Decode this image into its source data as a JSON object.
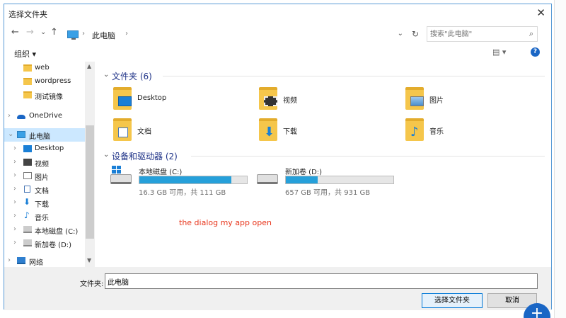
{
  "window": {
    "title": "选择文件夹",
    "close_glyph": "✕"
  },
  "nav": {
    "back": "←",
    "forward": "→",
    "recent": "⌄",
    "up": "↑",
    "breadcrumb": [
      "此电脑"
    ],
    "dropdown": "⌄",
    "refresh": "↻",
    "search_placeholder": "搜索\"此电脑\"",
    "search_icon": "⌕"
  },
  "toolbar": {
    "organize": "组织 ▾",
    "view_icon": "▤ ▾",
    "help": "?"
  },
  "sidebar": {
    "items": [
      {
        "label": "web",
        "icon": "folder-icon",
        "level": 2
      },
      {
        "label": "wordpress",
        "icon": "folder-icon",
        "level": 2
      },
      {
        "label": "测试镜像",
        "icon": "folder-icon",
        "level": 2
      },
      {
        "label": "OneDrive",
        "icon": "onedrive-icon",
        "level": 0,
        "arrow": "›"
      },
      {
        "label": "此电脑",
        "icon": "pc-icon",
        "level": 0,
        "arrow": "⌄",
        "selected": true
      },
      {
        "label": "Desktop",
        "icon": "desktop-icon",
        "level": 1,
        "arrow": "›"
      },
      {
        "label": "视频",
        "icon": "video-icon",
        "level": 1,
        "arrow": "›"
      },
      {
        "label": "图片",
        "icon": "picture-icon",
        "level": 1,
        "arrow": "›"
      },
      {
        "label": "文档",
        "icon": "document-icon",
        "level": 1,
        "arrow": "›"
      },
      {
        "label": "下载",
        "icon": "download-icon",
        "level": 1,
        "arrow": "›"
      },
      {
        "label": "音乐",
        "icon": "music-icon",
        "level": 1,
        "arrow": "›"
      },
      {
        "label": "本地磁盘 (C:)",
        "icon": "local-disk-icon",
        "level": 1,
        "arrow": "›"
      },
      {
        "label": "新加卷 (D:)",
        "icon": "drive-icon",
        "level": 1,
        "arrow": "›"
      },
      {
        "label": "网络",
        "icon": "network-icon",
        "level": 0,
        "arrow": "›"
      }
    ]
  },
  "groups": {
    "folders": {
      "title": "文件夹 (6)",
      "items": [
        {
          "name": "Desktop",
          "badge": "desktop"
        },
        {
          "name": "视频",
          "badge": "video"
        },
        {
          "name": "图片",
          "badge": "picture"
        },
        {
          "name": "文档",
          "badge": "document"
        },
        {
          "name": "下载",
          "badge": "download"
        },
        {
          "name": "音乐",
          "badge": "music"
        }
      ]
    },
    "drives": {
      "title": "设备和驱动器 (2)",
      "items": [
        {
          "name": "本地磁盘 (C:)",
          "info": "16.3 GB 可用，共 111 GB",
          "used_fraction": 0.853
        },
        {
          "name": "新加卷 (D:)",
          "info": "657 GB 可用，共 931 GB",
          "used_fraction": 0.294
        }
      ]
    }
  },
  "annotation": "the dialog my app open",
  "footer": {
    "folder_label": "文件夹:",
    "folder_value": "此电脑",
    "select_button": "选择文件夹",
    "cancel_button": "取消"
  },
  "background": {
    "plus": "+"
  },
  "colors": {
    "accent": "#0078d7",
    "selection": "#cce8ff",
    "drive_fill": "#26a0da",
    "annotation": "#e8351b",
    "group_title": "#1e3287"
  }
}
